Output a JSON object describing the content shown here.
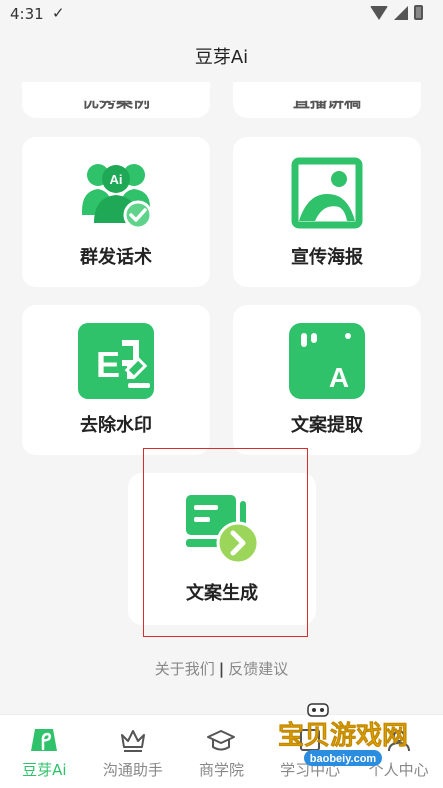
{
  "status_bar": {
    "time": "4:31"
  },
  "header": {
    "title": "豆芽Ai"
  },
  "cards": [
    {
      "label": "优秀案例",
      "icon": "showcase-icon",
      "partial": true
    },
    {
      "label": "直播讲稿",
      "icon": "script-icon",
      "partial": true
    },
    {
      "label": "群发话术",
      "icon": "ai-group-icon"
    },
    {
      "label": "宣传海报",
      "icon": "poster-icon"
    },
    {
      "label": "去除水印",
      "icon": "remove-watermark-icon"
    },
    {
      "label": "文案提取",
      "icon": "text-extract-icon"
    },
    {
      "label": "文案生成",
      "icon": "text-generate-icon"
    }
  ],
  "footer": {
    "about": "关于我们",
    "separator": "|",
    "feedback": "反馈建议"
  },
  "tabs": [
    {
      "label": "豆芽Ai",
      "icon": "sprout-icon",
      "active": true
    },
    {
      "label": "沟通助手",
      "icon": "crown-icon"
    },
    {
      "label": "商学院",
      "icon": "graduation-cap-icon"
    },
    {
      "label": "学习中心",
      "icon": "book-icon"
    },
    {
      "label": "个人中心",
      "icon": "person-icon"
    }
  ],
  "watermark": {
    "brand": "宝贝游戏网",
    "url": "baobeiy.com"
  },
  "colors": {
    "accent": "#2fc26a",
    "highlight_border": "#d32f2f"
  }
}
